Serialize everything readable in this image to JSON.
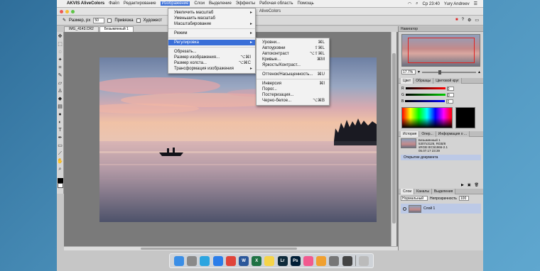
{
  "menubar": {
    "app_name": "AKVIS AliveColors",
    "items": [
      "Файл",
      "Редактирование",
      "Изображение",
      "Слои",
      "Выделение",
      "Эффекты",
      "Рабочая область",
      "Помощь"
    ],
    "active_item": "Изображение",
    "clock": "Ср 23:40",
    "user": "Yury Andreev"
  },
  "window": {
    "title": "AliveColors"
  },
  "options": {
    "size_label": "Размер, px",
    "size_value": "50",
    "snap_label": "Привязка",
    "thin_label": "Художест"
  },
  "tabs": [
    {
      "label": "IMG_4143.CR2"
    },
    {
      "label": "Безымянный 1"
    }
  ],
  "image_menu": {
    "items": [
      {
        "label": "Увеличить масштаб",
        "arrow": "▸"
      },
      {
        "label": "Уменьшить масштаб",
        "arrow": ""
      },
      {
        "label": "Масштабирование",
        "arrow": "▸"
      },
      {
        "label": "Режим",
        "arrow": "▸"
      },
      {
        "label": "Регулировка",
        "arrow": "▸"
      },
      {
        "label": "Обрезать...",
        "shortcut": ""
      },
      {
        "label": "Размер изображения...",
        "shortcut": "⌥⌘I"
      },
      {
        "label": "Размер холста...",
        "shortcut": "⌥⌘C"
      },
      {
        "label": "Трансформация изображения",
        "arrow": "▸"
      }
    ]
  },
  "adjust_menu": {
    "items": [
      {
        "label": "Уровни...",
        "shortcut": "⌘L"
      },
      {
        "label": "Автоуровни",
        "shortcut": "⇧⌘L"
      },
      {
        "label": "Автоконтраст",
        "shortcut": "⌥⇧⌘L"
      },
      {
        "label": "Кривые...",
        "shortcut": "⌘M"
      },
      {
        "label": "Яркость/Контраст...",
        "shortcut": ""
      },
      {
        "label": "Оттенок/Насыщенность...",
        "shortcut": "⌘U"
      },
      {
        "label": "Инверсия",
        "shortcut": "⌘I"
      },
      {
        "label": "Порог...",
        "shortcut": ""
      },
      {
        "label": "Постеризация...",
        "shortcut": ""
      },
      {
        "label": "Черно-белое...",
        "shortcut": "⌥⌘B"
      }
    ]
  },
  "navigator": {
    "title": "Навигатор",
    "zoom": "17.7%"
  },
  "color_panel": {
    "tabs": [
      "Цвет",
      "Образцы",
      "Цветовой круг"
    ],
    "channels": [
      "R",
      "G",
      "B"
    ],
    "values": [
      "0",
      "0",
      "0"
    ]
  },
  "history_panel": {
    "tabs": [
      "История",
      "Опер...",
      "Информация о ..."
    ],
    "doc_name": "Безымянный 1",
    "doc_size": "5307x3126, RGB/8",
    "doc_profile": "sRGB IEC61966-2.1",
    "doc_date": "05.07.17 23:39",
    "entries": [
      "Открытие документа"
    ]
  },
  "layers_panel": {
    "tabs": [
      "Слои",
      "Каналы",
      "Выделения"
    ],
    "blend_mode": "Нормальный",
    "opacity_label": "Непрозрачность",
    "opacity": "100",
    "layers": [
      "Слой 1"
    ]
  },
  "dock": {
    "icons": [
      "finder-icon",
      "launchpad-icon",
      "telegram-icon",
      "safari-icon",
      "chrome-icon",
      "word-icon",
      "excel-icon",
      "notes-icon",
      "lightroom-icon",
      "photoshop-icon",
      "music-icon",
      "ibooks-icon",
      "settings-icon",
      "aliveColors-icon",
      "trash-icon"
    ],
    "labels": [
      "",
      "",
      "",
      "",
      "",
      "W",
      "X",
      "",
      "Lr",
      "Ps",
      "",
      "",
      "",
      "",
      ""
    ],
    "colors": [
      "#3a8ee6",
      "#8a8a8a",
      "#2ca5e0",
      "#2b7de9",
      "#e0443a",
      "#2b579a",
      "#1f7244",
      "#f5d44a",
      "#0e2a3a",
      "#001e36",
      "#f25a8f",
      "#f0a030",
      "#777777",
      "#444444",
      "#bbbbbb"
    ]
  }
}
